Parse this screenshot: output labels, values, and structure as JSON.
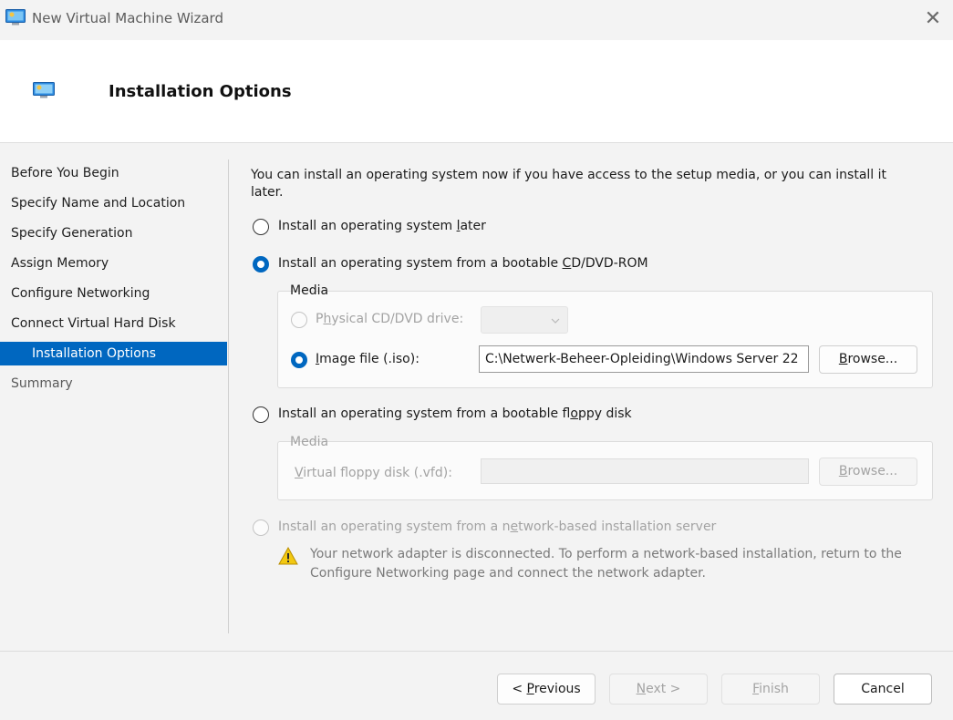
{
  "window": {
    "title": "New Virtual Machine Wizard",
    "close_glyph": "✕"
  },
  "header": {
    "title": "Installation Options"
  },
  "nav": {
    "items": [
      "Before You Begin",
      "Specify Name and Location",
      "Specify Generation",
      "Assign Memory",
      "Configure Networking",
      "Connect Virtual Hard Disk",
      "Installation Options",
      "Summary"
    ],
    "selected_index": 6
  },
  "content": {
    "intro_line1": "You can install an operating system now if you have access to the setup media, or you can install it",
    "intro_line2": "later.",
    "option_later": {
      "pre": "Install an operating system ",
      "key": "l",
      "post": "ater",
      "selected": false
    },
    "option_cd": {
      "pre": "Install an operating system from a bootable ",
      "key": "C",
      "post": "D/DVD-ROM",
      "selected": true
    },
    "media_label": "Media",
    "physical_drive": {
      "pre": "P",
      "key": "h",
      "post": "ysical CD/DVD drive:",
      "selected": false,
      "enabled": false
    },
    "image_file": {
      "pre": "",
      "key": "I",
      "post": "mage file (.iso):",
      "selected": true,
      "value": "C:\\Netwerk-Beheer-Opleiding\\Windows Server 22"
    },
    "browse_label_key": "B",
    "browse_label_rest": "rowse...",
    "option_floppy": {
      "pre": "Install an operating system from a bootable fl",
      "key": "o",
      "post": "ppy disk",
      "selected": false
    },
    "floppy_media_label": "Media",
    "floppy_field": {
      "pre": "",
      "key": "V",
      "post": "irtual floppy disk (.vfd):",
      "value": ""
    },
    "option_network": {
      "pre": "Install an operating system from a n",
      "key": "e",
      "post": "twork-based installation server",
      "selected": false,
      "enabled": false
    },
    "warning_line1": "Your network adapter is disconnected. To perform a network-based installation, return to the",
    "warning_line2": "Configure Networking page and connect the network adapter."
  },
  "footer": {
    "previous": {
      "pre": "< ",
      "key": "P",
      "post": "revious"
    },
    "next": {
      "pre": "",
      "key": "N",
      "post": "ext >"
    },
    "finish": {
      "pre": "",
      "key": "F",
      "post": "inish"
    },
    "cancel": "Cancel"
  },
  "colors": {
    "accent": "#0067c0",
    "warning": "#f2c811"
  }
}
